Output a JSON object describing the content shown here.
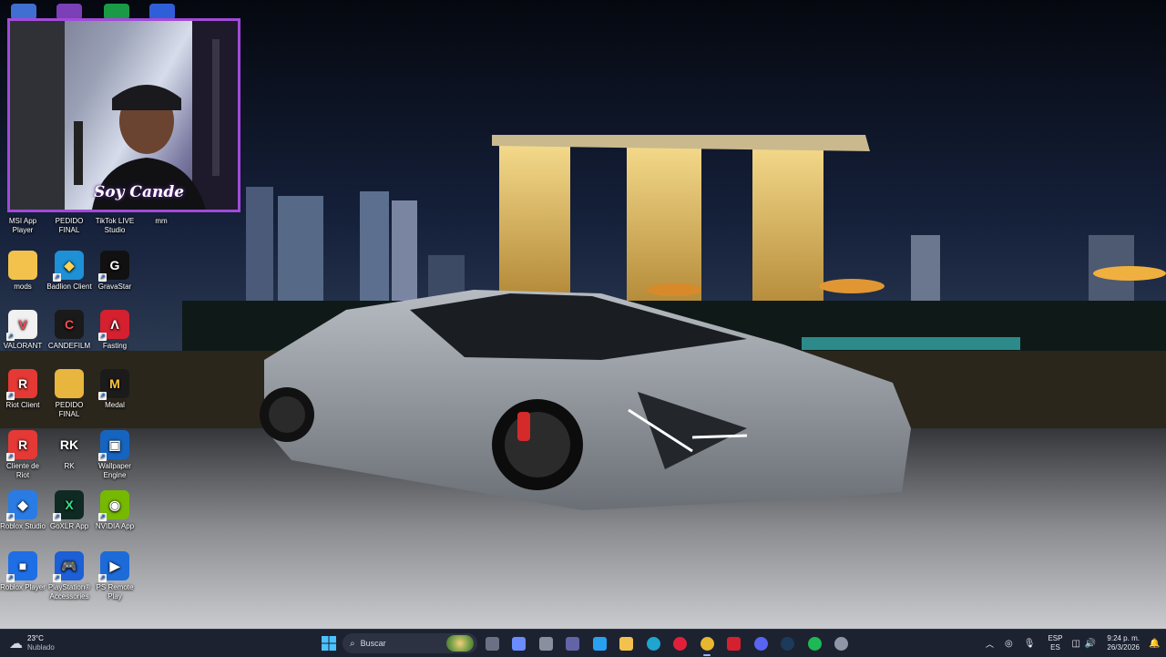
{
  "webcam": {
    "logo_text": "Soy Cande"
  },
  "top_strip_icons": [
    {
      "name": "app-icon-1",
      "color": "#3f6fd0"
    },
    {
      "name": "app-icon-2",
      "color": "#7b3fb8"
    },
    {
      "name": "app-icon-3",
      "color": "#1a9a45"
    },
    {
      "name": "app-icon-4",
      "color": "#2f5fd8"
    }
  ],
  "desktop_icons": [
    {
      "label": "MSI App Player",
      "glyph": "▶",
      "bg": "#1b1f2a",
      "fg": "#62d3ff",
      "shortcut": true
    },
    {
      "label": "PEDIDO FINAL",
      "glyph": "",
      "bg": "#d9a436",
      "fg": "#fff",
      "shortcut": false
    },
    {
      "label": "TikTok LIVE Studio",
      "glyph": "♪",
      "bg": "#000000",
      "fg": "#ff3b5c",
      "shortcut": true
    },
    {
      "label": "mm",
      "glyph": "",
      "bg": "transparent",
      "fg": "#fff",
      "shortcut": false
    },
    {
      "label": "mods",
      "glyph": "",
      "bg": "#f3c24d",
      "fg": "#fff",
      "shortcut": false
    },
    {
      "label": "Badlion Client",
      "glyph": "◆",
      "bg": "#1e90d6",
      "fg": "#ffd451",
      "shortcut": true
    },
    {
      "label": "GravaStar",
      "glyph": "G",
      "bg": "#111111",
      "fg": "#ffffff",
      "shortcut": true
    },
    {
      "label": "VALORANT",
      "glyph": "V",
      "bg": "#f1f1f1",
      "fg": "#ff4655",
      "shortcut": true
    },
    {
      "label": "CANDEFILM",
      "glyph": "C",
      "bg": "#1a1a1a",
      "fg": "#ff4b4b",
      "shortcut": false
    },
    {
      "label": "Fasting",
      "glyph": "Λ",
      "bg": "#d4202f",
      "fg": "#ffffff",
      "shortcut": true
    },
    {
      "label": "Riot Client",
      "glyph": "R",
      "bg": "#e53935",
      "fg": "#ffffff",
      "shortcut": true
    },
    {
      "label": "PEDIDO FINAL",
      "glyph": "",
      "bg": "#e8b53f",
      "fg": "#fff",
      "shortcut": false
    },
    {
      "label": "Medal",
      "glyph": "M",
      "bg": "#1b1b1b",
      "fg": "#ffc43d",
      "shortcut": true
    },
    {
      "label": "Cliente de Riot",
      "glyph": "R",
      "bg": "#e53935",
      "fg": "#ffffff",
      "shortcut": true
    },
    {
      "label": "RK",
      "glyph": "RK",
      "bg": "transparent",
      "fg": "#ffffff",
      "shortcut": false
    },
    {
      "label": "Wallpaper Engine",
      "glyph": "▣",
      "bg": "#1565c0",
      "fg": "#ffffff",
      "shortcut": true
    },
    {
      "label": "Roblox Studio",
      "glyph": "◆",
      "bg": "#2a7be4",
      "fg": "#ffffff",
      "shortcut": true
    },
    {
      "label": "GoXLR App",
      "glyph": "X",
      "bg": "#0f2a22",
      "fg": "#36e08a",
      "shortcut": true
    },
    {
      "label": "NVIDIA App",
      "glyph": "◉",
      "bg": "#76b900",
      "fg": "#ffffff",
      "shortcut": true
    },
    {
      "label": "Roblox Player",
      "glyph": "■",
      "bg": "#1e6ee6",
      "fg": "#ffffff",
      "shortcut": true
    },
    {
      "label": "PlayStation® Accessories",
      "glyph": "🎮",
      "bg": "#1c5fd6",
      "fg": "#ffffff",
      "shortcut": true
    },
    {
      "label": "PS Remote Play",
      "glyph": "▶",
      "bg": "#1c6bd8",
      "fg": "#ffffff",
      "shortcut": true
    }
  ],
  "taskbar": {
    "weather": {
      "temp": "23°C",
      "condition": "Nublado"
    },
    "search_placeholder": "Buscar",
    "apps": [
      {
        "name": "file-explorer-small",
        "color": "#6a7185"
      },
      {
        "name": "copilot",
        "color": "#6b8cff"
      },
      {
        "name": "app-a",
        "color": "#8a8fa0"
      },
      {
        "name": "teams",
        "color": "#6264a7"
      },
      {
        "name": "store",
        "color": "#2aa0f0"
      },
      {
        "name": "file-explorer",
        "color": "#f2c14e"
      },
      {
        "name": "edge",
        "color": "#1fa5d0"
      },
      {
        "name": "opera",
        "color": "#e0203b"
      },
      {
        "name": "chrome",
        "color": "#e8b730"
      },
      {
        "name": "app-lambda",
        "color": "#d4202f"
      },
      {
        "name": "discord",
        "color": "#5865f2"
      },
      {
        "name": "steam",
        "color": "#1b3a5c"
      },
      {
        "name": "spotify",
        "color": "#1db954"
      },
      {
        "name": "settings",
        "color": "#8f96a8"
      }
    ],
    "language": {
      "top": "ESP",
      "bottom": "ES"
    },
    "time": "9:24 p. m.",
    "date": "26/3/2026"
  }
}
